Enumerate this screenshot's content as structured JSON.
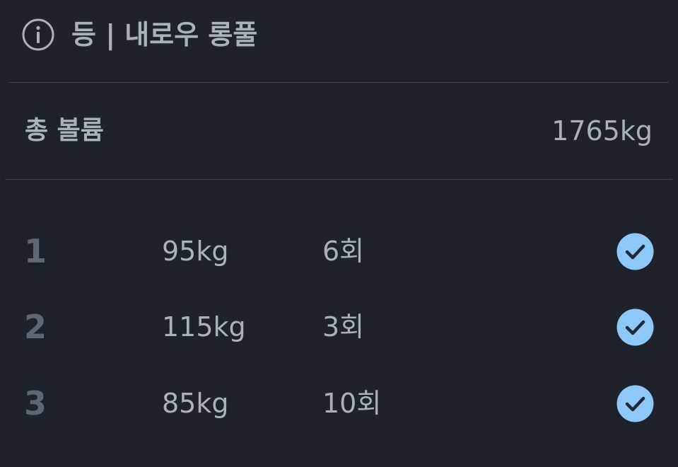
{
  "header": {
    "title": "등 | 내로우 롱풀",
    "icon": "info-icon"
  },
  "summary": {
    "label": "총 볼륨",
    "value": "1765kg"
  },
  "sets": [
    {
      "number": "1",
      "weight": "95kg",
      "reps": "6회",
      "completed": true
    },
    {
      "number": "2",
      "weight": "115kg",
      "reps": "3회",
      "completed": true
    },
    {
      "number": "3",
      "weight": "85kg",
      "reps": "10회",
      "completed": true
    }
  ],
  "colors": {
    "background": "#1e222a",
    "text": "#a9b1ba",
    "muted": "#5d6874",
    "check_fill": "#8ec8f8",
    "check_mark": "#1e2a38"
  }
}
